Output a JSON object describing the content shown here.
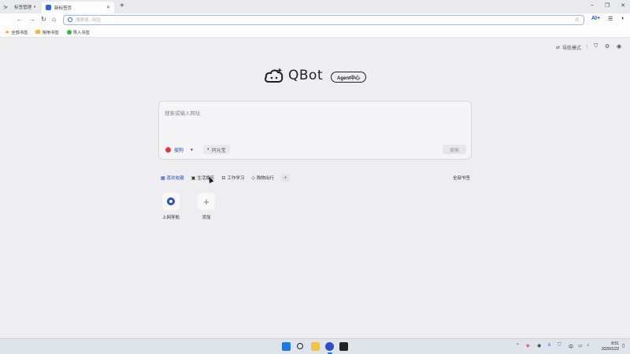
{
  "tabstrip": {
    "group_label": "标签管理",
    "active_tab_title": "新标签页",
    "new_tab_symbol": "+"
  },
  "toolbar": {
    "omnibox_placeholder": "搜索或...网址",
    "ai_label": "AI+"
  },
  "bookmarks_bar": [
    {
      "label": "全部书签",
      "icon": "star-icon"
    },
    {
      "label": "常用书签",
      "icon": "folder-icon"
    },
    {
      "label": "导入书签",
      "icon": "import-icon"
    }
  ],
  "top_right": {
    "nav_mode_label": "导航模式"
  },
  "logo": {
    "text": "QBot",
    "agent_badge": "Agent中心"
  },
  "search": {
    "placeholder": "搜索或输入网址",
    "engine": "搜狗",
    "yuanbao": "问元宝",
    "search_button": "搜索"
  },
  "categories": [
    {
      "label": "喜欢收藏",
      "icon": "grid-icon",
      "active": true
    },
    {
      "label": "生活娱乐",
      "icon": "tv-icon",
      "active": false
    },
    {
      "label": "工作学习",
      "icon": "briefcase-icon",
      "active": false
    },
    {
      "label": "购物出行",
      "icon": "tag-icon",
      "active": false
    }
  ],
  "all_bookmarks_link": "全部书签",
  "shortcuts": [
    {
      "label": "上网导航",
      "icon": "qbrowser-icon"
    },
    {
      "label": "添加",
      "icon": "plus-icon"
    }
  ],
  "taskbar": {
    "ime_label": "中",
    "time": "8:51",
    "date": "2026/1/22"
  },
  "colors": {
    "accent": "#2b4fc7",
    "page_background": "#eeeef0"
  }
}
